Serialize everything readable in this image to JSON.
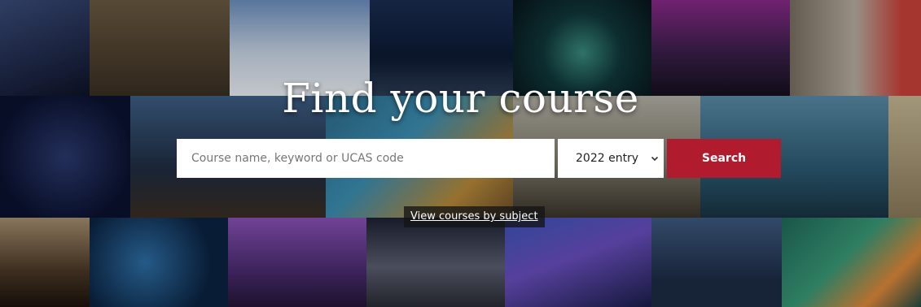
{
  "hero": {
    "title": "Find your course",
    "search_placeholder": "Course name, keyword or UCAS code",
    "entry_select": {
      "selected": "2022 entry"
    },
    "search_button": "Search",
    "subject_link": "View courses by subject"
  },
  "colors": {
    "search_button": "#b01c2e",
    "title_text": "#ffffff"
  }
}
